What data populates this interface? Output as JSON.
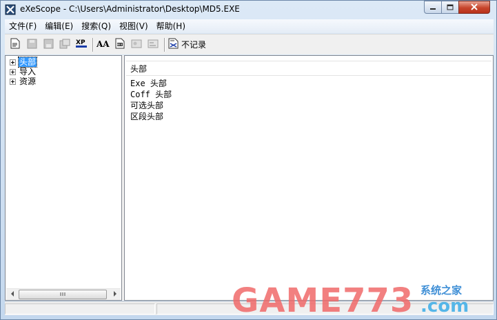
{
  "window": {
    "title": "eXeScope - C:\\Users\\Administrator\\Desktop\\MD5.EXE"
  },
  "menu": {
    "items": [
      "文件(F)",
      "编辑(E)",
      "搜索(Q)",
      "视图(V)",
      "帮助(H)"
    ]
  },
  "toolbar": {
    "norecord_label": "不记录",
    "xp_label": "XP",
    "font_label": "AA"
  },
  "tree": {
    "items": [
      {
        "label": "头部",
        "selected": true
      },
      {
        "label": "导入",
        "selected": false
      },
      {
        "label": "资源",
        "selected": false
      }
    ]
  },
  "content": {
    "column_header": "头部",
    "rows": [
      "Exe 头部",
      "Coff 头部",
      "可选头部",
      "区段头部"
    ]
  },
  "watermark": {
    "text": "GAME773",
    "cn": "系统之家",
    "com": ".com"
  },
  "colors": {
    "selection": "#3399ff",
    "close_button": "#c7452c",
    "watermark_red": "#f06a6a",
    "watermark_blue": "#3f8fd6"
  }
}
